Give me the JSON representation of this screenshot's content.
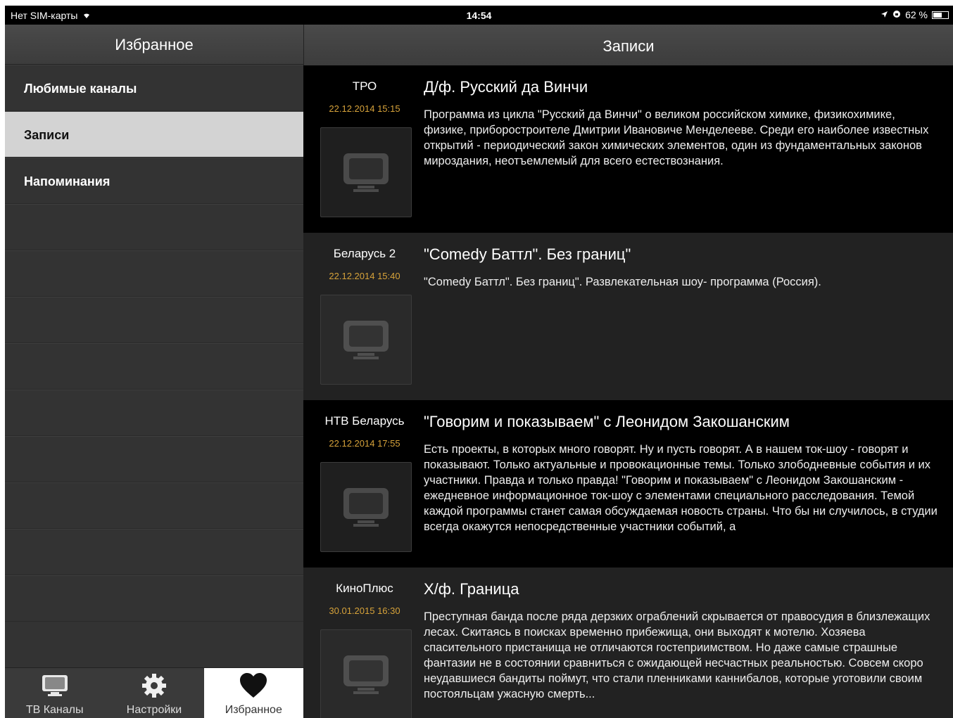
{
  "status_bar": {
    "carrier": "Нет SIM-карты",
    "time": "14:54",
    "battery": "62 %",
    "battery_level": 0.62
  },
  "sidebar": {
    "title": "Избранное",
    "items": [
      {
        "label": "Любимые каналы",
        "active": false
      },
      {
        "label": "Записи",
        "active": true
      },
      {
        "label": "Напоминания",
        "active": false
      }
    ]
  },
  "tabbar": {
    "tabs": [
      {
        "label": "ТВ Каналы",
        "icon": "tv-icon",
        "active": false
      },
      {
        "label": "Настройки",
        "icon": "gear-icon",
        "active": false
      },
      {
        "label": "Избранное",
        "icon": "heart-icon",
        "active": true
      }
    ]
  },
  "main": {
    "title": "Записи",
    "records": [
      {
        "channel": "ТРО",
        "datetime": "22.12.2014 15:15",
        "title": "Д/ф. Русский да Винчи",
        "description": "Программа из цикла \"Русский да Винчи\"  о великом российском химике, физикохимике, физике, приборостроителе Дмитрии Ивановиче Менделееве. Среди его наиболее известных открытий - периодический закон химических элементов, один из фундаментальных законов мироздания, неотъемлемый для всего естествознания."
      },
      {
        "channel": "Беларусь 2",
        "datetime": "22.12.2014 15:40",
        "title": "\"Comedy Баттл\". Без границ\"",
        "description": "\"Comedy Баттл\". Без границ\". Развлекательная шоу- программа (Россия)."
      },
      {
        "channel": "НТВ Беларусь",
        "datetime": "22.12.2014 17:55",
        "title": "\"Говорим и показываем\" с Леонидом Закошанским",
        "description": "Есть проекты, в которых много говорят. Ну и пусть говорят. А в нашем ток-шоу - говорят и показывают. Только актуальные и провокационные темы. Только злободневные события и их участники. Правда и только правда! \"Говорим и показываем\" с Леонидом Закошанским - ежедневное информационное ток-шоу с элементами специального расследования. Темой каждой программы станет самая обсуждаемая новость страны. Что бы ни случилось, в студии всегда окажутся непосредственные участники событий, а"
      },
      {
        "channel": "КиноПлюс",
        "datetime": "30.01.2015 16:30",
        "title": "Х/ф. Граница",
        "description": "Преступная банда после ряда дерзких ограблений скрывается от правосудия в близлежащих лесах. Скитаясь в поисках временно прибежища, они выходят к мотелю. Хозяева спасительного пристанища не отличаются гостеприимством. Но даже самые страшные фантазии не в состоянии сравниться с ожидающей несчастных реальностью. Совсем скоро неудавшиеся бандиты поймут, что стали пленниками каннибалов, которые уготовили своим постояльцам ужасную смерть..."
      }
    ]
  },
  "colors": {
    "accent_time": "#d6a23a",
    "sidebar_bg": "#333333",
    "active_row": "#d3d3d3"
  }
}
